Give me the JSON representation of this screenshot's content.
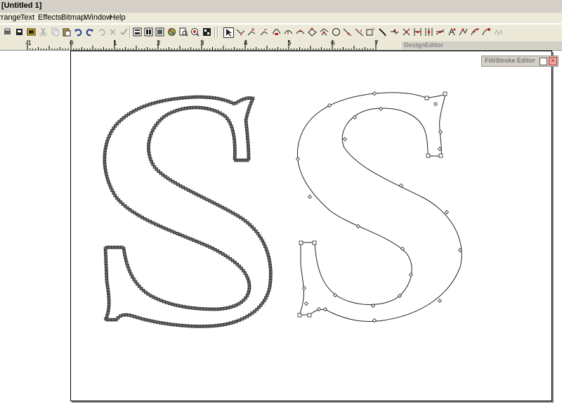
{
  "window": {
    "title": "[Untitled 1]"
  },
  "menu": {
    "items": [
      "rrange",
      "Text",
      "Effects",
      "Bitmap",
      "Window",
      "Help"
    ]
  },
  "toolbar": {
    "left_icons": [
      "print-icon",
      "print-preview-icon",
      "publish-icon",
      "cut-icon",
      "copy-icon",
      "paste-icon",
      "undo-icon",
      "redo-icon",
      "repeat-icon",
      "clear-icon",
      "spellcheck-icon",
      "view-1-icon",
      "view-2-icon",
      "view-3-icon",
      "color-icon",
      "zoom-page-icon",
      "zoom-icon",
      "fullscreen-icon"
    ],
    "node_icons": [
      "pointer-tool-icon",
      "node-move-icon",
      "node-add-icon",
      "node-delete-icon",
      "node-join-icon",
      "node-break-icon",
      "curve-icon",
      "line-icon",
      "smooth-icon",
      "corner-icon",
      "circle-node-icon",
      "segment-icon",
      "reverse-icon",
      "close-path-icon",
      "pin-icon",
      "cut-path-icon",
      "align-left-icon",
      "align-center-icon",
      "align-right-icon",
      "distribute-icon",
      "auto-node-icon",
      "reduce-nodes-icon",
      "add-nodes-icon",
      "optimize-icon"
    ]
  },
  "ruler": {
    "labels": [
      "-1",
      "0",
      "1",
      "2",
      "3",
      "4",
      "5",
      "6",
      "7"
    ]
  },
  "panels": {
    "design_editor": "DesignEditor",
    "fill_stroke": "Fill/Stroke Editor"
  },
  "accent_colors": {
    "chrome": "#ece9d8",
    "panel": "#d4d0c8",
    "close_button": "#f5a8a0"
  }
}
